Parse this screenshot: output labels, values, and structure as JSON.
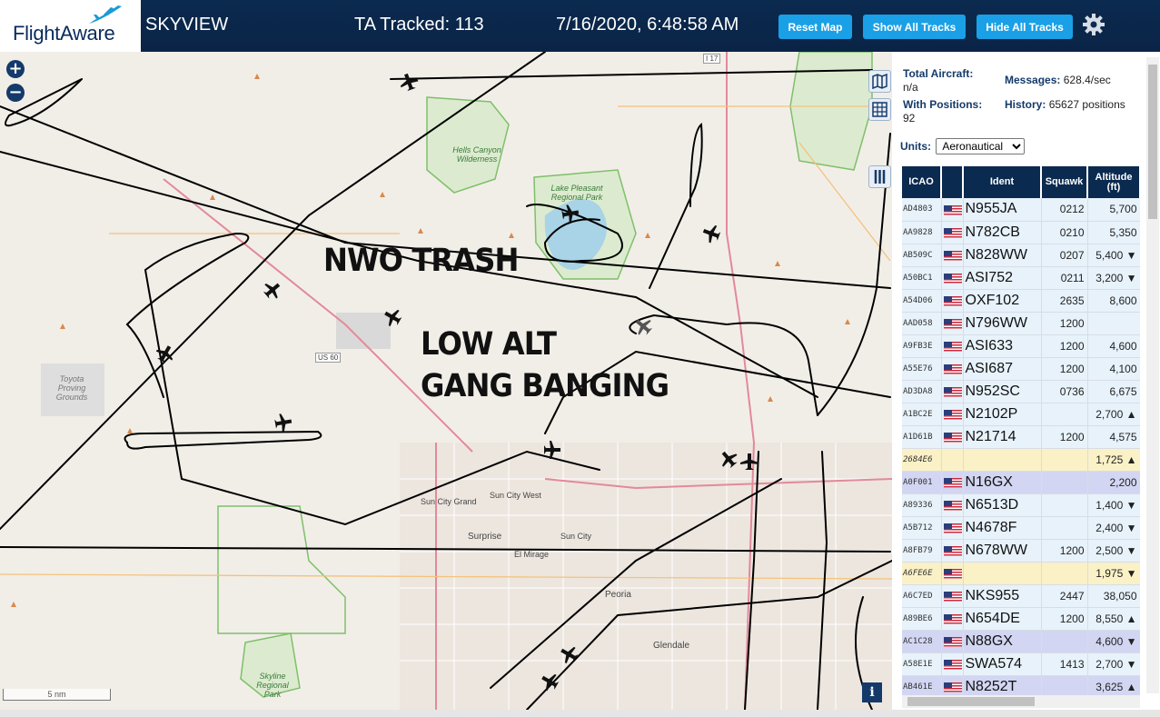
{
  "header": {
    "logo_text": "FlightAware",
    "app_title": "SKYVIEW",
    "tracked_label": "TA Tracked:",
    "tracked_count": "113",
    "datetime": "7/16/2020, 6:48:58 AM",
    "buttons": {
      "reset": "Reset Map",
      "show": "Show All Tracks",
      "hide": "Hide All Tracks"
    },
    "gear_icon": "gear-icon"
  },
  "map": {
    "annotations": [
      "NWO TRASH",
      "LOW ALT",
      "GANG BANGING"
    ],
    "zoom_in": "+",
    "zoom_out": "−",
    "scale_label": "5 nm",
    "info_label": "i",
    "places": {
      "hells_canyon": "Hells Canyon Wilderness",
      "lake_pleasant": "Lake Pleasant Regional Park",
      "toyota": "Toyota Proving Grounds",
      "sun_city_grand": "Sun City Grand",
      "sun_city_west": "Sun City West",
      "surprise": "Surprise",
      "el_mirage": "El Mirage",
      "sun_city": "Sun City",
      "peoria": "Peoria",
      "glendale": "Glendale",
      "skyline": "Skyline Regional Park",
      "us60": "US 60",
      "i17": "I 17"
    },
    "water_color": "#a9d3e6",
    "park_color": "#d7e8c4",
    "track_color": "#000000"
  },
  "panel": {
    "total_aircraft_label": "Total Aircraft:",
    "total_aircraft_value": "n/a",
    "messages_label": "Messages:",
    "messages_value": "628.4/sec",
    "with_positions_label": "With Positions:",
    "with_positions_value": "92",
    "history_label": "History:",
    "history_value": "65627 positions",
    "units_label": "Units:",
    "units_selected": "Aeronautical",
    "columns": {
      "icao": "ICAO",
      "flag": "",
      "ident": "Ident",
      "squawk": "Squawk",
      "altitude": "Altitude (ft)"
    },
    "rows": [
      {
        "icao": "AD4803",
        "ident": "N955JA",
        "squawk": "0212",
        "alt": "5,700",
        "flag": true,
        "style": "normal"
      },
      {
        "icao": "AA9828",
        "ident": "N782CB",
        "squawk": "0210",
        "alt": "5,350",
        "flag": true,
        "style": "normal"
      },
      {
        "icao": "AB509C",
        "ident": "N828WW",
        "squawk": "0207",
        "alt": "5,400 ▼",
        "flag": true,
        "style": "normal"
      },
      {
        "icao": "A50BC1",
        "ident": "ASI752",
        "squawk": "0211",
        "alt": "3,200 ▼",
        "flag": true,
        "style": "normal"
      },
      {
        "icao": "A54D06",
        "ident": "OXF102",
        "squawk": "2635",
        "alt": "8,600",
        "flag": true,
        "style": "normal"
      },
      {
        "icao": "AAD058",
        "ident": "N796WW",
        "squawk": "1200",
        "alt": "",
        "flag": true,
        "style": "normal"
      },
      {
        "icao": "A9FB3E",
        "ident": "ASI633",
        "squawk": "1200",
        "alt": "4,600",
        "flag": true,
        "style": "normal"
      },
      {
        "icao": "A55E76",
        "ident": "ASI687",
        "squawk": "1200",
        "alt": "4,100",
        "flag": true,
        "style": "normal"
      },
      {
        "icao": "AD3DA8",
        "ident": "N952SC",
        "squawk": "0736",
        "alt": "6,675",
        "flag": true,
        "style": "normal"
      },
      {
        "icao": "A1BC2E",
        "ident": "N2102P",
        "squawk": "",
        "alt": "2,700 ▲",
        "flag": true,
        "style": "normal"
      },
      {
        "icao": "A1D61B",
        "ident": "N21714",
        "squawk": "1200",
        "alt": "4,575",
        "flag": true,
        "style": "normal"
      },
      {
        "icao": "2684E6",
        "ident": "",
        "squawk": "",
        "alt": "1,725 ▲",
        "flag": false,
        "style": "yellow"
      },
      {
        "icao": "A0F001",
        "ident": "N16GX",
        "squawk": "",
        "alt": "2,200",
        "flag": true,
        "style": "purple"
      },
      {
        "icao": "A89336",
        "ident": "N6513D",
        "squawk": "",
        "alt": "1,400 ▼",
        "flag": true,
        "style": "normal"
      },
      {
        "icao": "A5B712",
        "ident": "N4678F",
        "squawk": "",
        "alt": "2,400 ▼",
        "flag": true,
        "style": "normal"
      },
      {
        "icao": "A8FB79",
        "ident": "N678WW",
        "squawk": "1200",
        "alt": "2,500 ▼",
        "flag": true,
        "style": "normal"
      },
      {
        "icao": "A6FE6E",
        "ident": "",
        "squawk": "",
        "alt": "1,975 ▼",
        "flag": true,
        "style": "yellow"
      },
      {
        "icao": "A6C7ED",
        "ident": "NKS955",
        "squawk": "2447",
        "alt": "38,050",
        "flag": true,
        "style": "normal"
      },
      {
        "icao": "A89BE6",
        "ident": "N654DE",
        "squawk": "1200",
        "alt": "8,550 ▲",
        "flag": true,
        "style": "normal"
      },
      {
        "icao": "AC1C28",
        "ident": "N88GX",
        "squawk": "",
        "alt": "4,600 ▼",
        "flag": true,
        "style": "purple"
      },
      {
        "icao": "A58E1E",
        "ident": "SWA574",
        "squawk": "1413",
        "alt": "2,700 ▼",
        "flag": true,
        "style": "normal"
      },
      {
        "icao": "AB461E",
        "ident": "N8252T",
        "squawk": "",
        "alt": "3,625 ▲",
        "flag": true,
        "style": "purple"
      }
    ]
  }
}
